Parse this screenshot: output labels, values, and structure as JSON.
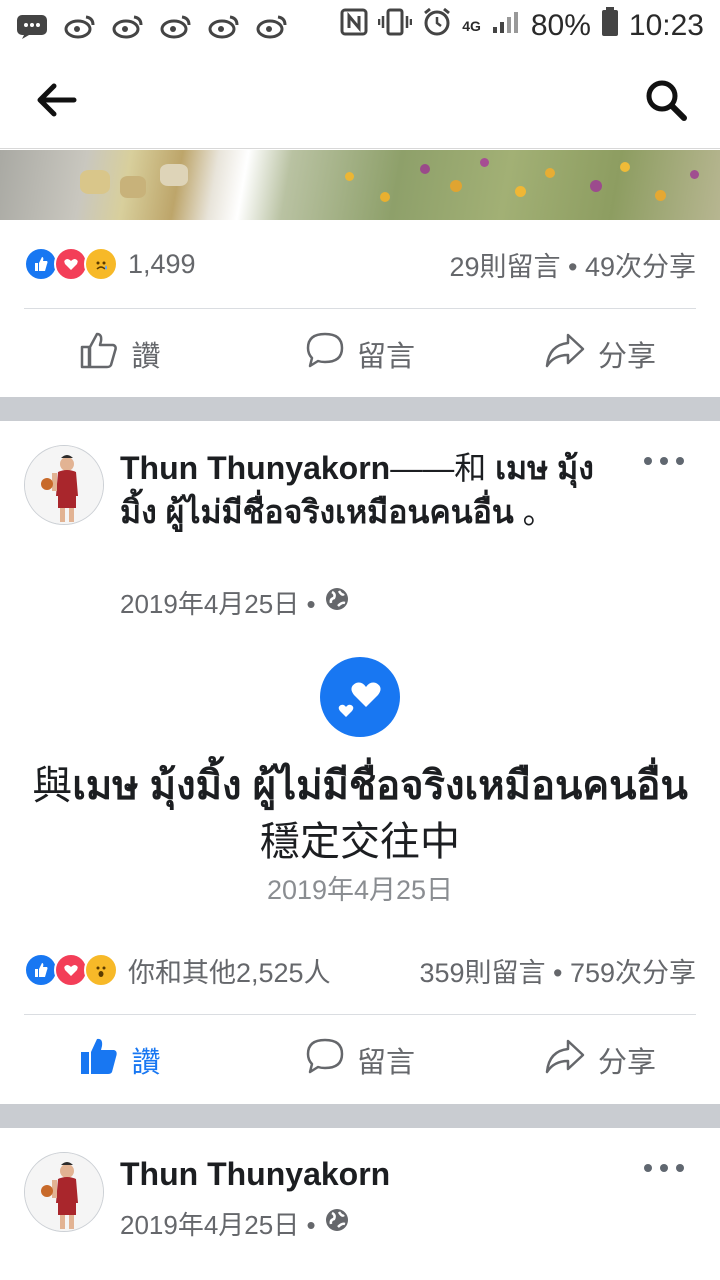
{
  "status_bar": {
    "battery": "80%",
    "time": "10:23",
    "network": "4G"
  },
  "post1": {
    "reaction_count": "1,499",
    "stats": "29則留言 • 49次分享",
    "actions": {
      "like": "讚",
      "comment": "留言",
      "share": "分享"
    }
  },
  "post2": {
    "author": "Thun Thunyakorn",
    "with_connector": "——和 ",
    "with_name": "เมษ มุ้งมิ้ง ผู้ไม่มีชื่อจริงเหมือนคนอื่น",
    "title_end": " 。",
    "date": "2019年4月25日 •",
    "event_prefix": "與",
    "event_name": "เมษ มุ้งมิ้ง ผู้ไม่มีชื่อจริงเหมือนคนอื่น",
    "event_suffix": "穩定交往中",
    "event_date": "2019年4月25日",
    "reaction_text": "你和其他2,525人",
    "stats": "359則留言 • 759次分享",
    "actions": {
      "like": "讚",
      "comment": "留言",
      "share": "分享"
    }
  },
  "post3": {
    "author": "Thun Thunyakorn",
    "date": "2019年4月25日 •"
  },
  "colors": {
    "accent": "#1877f2",
    "love": "#f33e58",
    "separator": "#c9ccd1"
  }
}
